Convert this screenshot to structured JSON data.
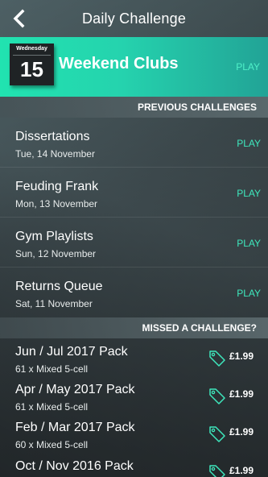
{
  "header": {
    "title": "Daily Challenge",
    "back_icon": "chevron-left-icon"
  },
  "today": {
    "weekday": "Wednesday",
    "day": "15",
    "title": "Weekend Clubs",
    "play_label": "PLAY"
  },
  "previous": {
    "heading": "PREVIOUS CHALLENGES",
    "items": [
      {
        "title": "Dissertations",
        "date": "Tue, 14 November",
        "play_label": "PLAY"
      },
      {
        "title": "Feuding Frank",
        "date": "Mon, 13 November",
        "play_label": "PLAY"
      },
      {
        "title": "Gym Playlists",
        "date": "Sun, 12 November",
        "play_label": "PLAY"
      },
      {
        "title": "Returns Queue",
        "date": "Sat, 11 November",
        "play_label": "PLAY"
      }
    ]
  },
  "missed": {
    "heading": "MISSED A CHALLENGE?",
    "packs": [
      {
        "title": "Jun / Jul 2017 Pack",
        "detail": "61 x Mixed 5-cell",
        "price": "£1.99"
      },
      {
        "title": "Apr / May 2017 Pack",
        "detail": "61 x Mixed 5-cell",
        "price": "£1.99"
      },
      {
        "title": "Feb / Mar 2017 Pack",
        "detail": "60 x Mixed 5-cell",
        "price": "£1.99"
      },
      {
        "title": "Oct / Nov 2016 Pack",
        "detail": "",
        "price": "£1.99"
      }
    ]
  },
  "colors": {
    "accent": "#21e3b0",
    "play": "#3ee8bd",
    "tag": "#3ee8bd"
  }
}
